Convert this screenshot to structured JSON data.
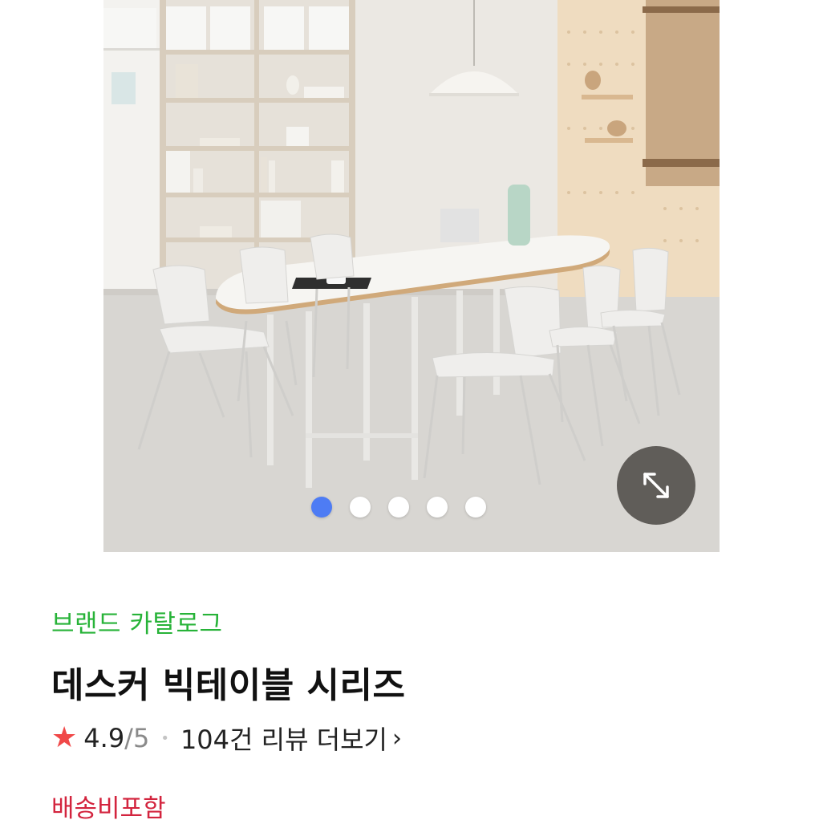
{
  "gallery": {
    "expand_icon": "expand-arrows-icon",
    "dots_total": 5,
    "active_dot": 1,
    "colors": {
      "active_dot": "#4e7cf4",
      "inactive_dot": "#ffffff"
    }
  },
  "product": {
    "brand_catalog": "브랜드 카탈로그",
    "title": "데스커 빅테이블 시리즈",
    "rating": {
      "star_icon": "star-icon",
      "score": "4.9",
      "max": "/5",
      "separator": "•",
      "review_text": "104건 리뷰 더보기",
      "chevron": "›"
    },
    "shipping": "배송비포함"
  },
  "colors": {
    "brand": "#27b338",
    "star": "#f04848",
    "shipping": "#d3243e"
  }
}
